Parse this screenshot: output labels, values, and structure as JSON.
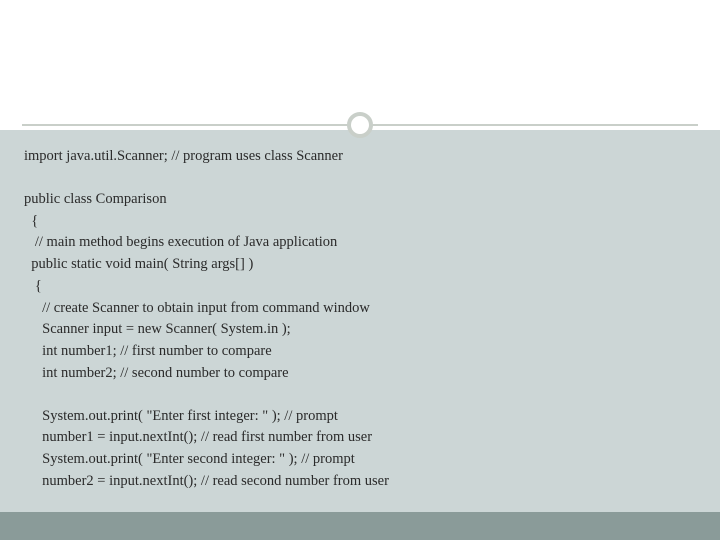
{
  "code": {
    "l1": "import java.util.Scanner; // program uses class Scanner",
    "l2": "public class Comparison",
    "l3": "  {",
    "l4": "   // main method begins execution of Java application",
    "l5": "  public static void main( String args[] )",
    "l6": "   {",
    "l7": "     // create Scanner to obtain input from command window",
    "l8": "     Scanner input = new Scanner( System.in );",
    "l9": "     int number1; // first number to compare",
    "l10": "     int number2; // second number to compare",
    "l11": "     System.out.print( \"Enter first integer: \" ); // prompt",
    "l12": "     number1 = input.nextInt(); // read first number from user",
    "l13": "     System.out.print( \"Enter second integer: \" ); // prompt",
    "l14": "     number2 = input.nextInt(); // read second number from user"
  }
}
